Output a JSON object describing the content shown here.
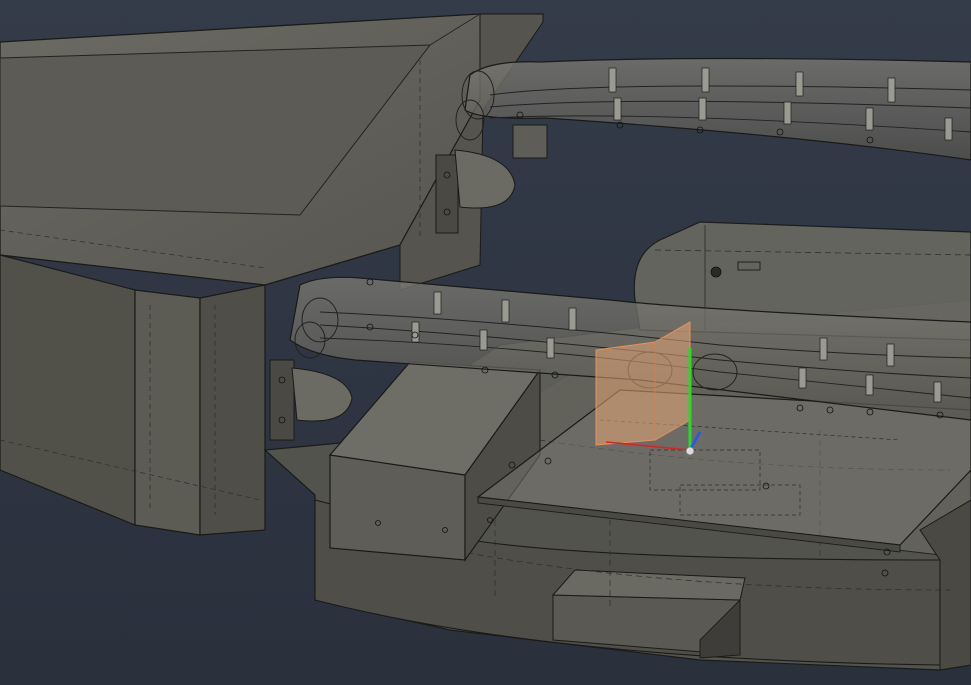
{
  "scene": {
    "kind": "cad-3d-viewport",
    "render_style": "translucent shaded with visible hidden edges",
    "colors": {
      "background_top": "#333a48",
      "background_bottom": "#2a303c",
      "body": "#5f5e58",
      "body_dark": "#4b4a45",
      "body_light": "#7a7971",
      "edge": "#1a1a18",
      "hidden_edge": "#2e2e2b",
      "plane": "#e8a878",
      "axis_y": "#22dd22",
      "axis_z": "#2255ff",
      "axis_x": "#dd2222"
    },
    "selected_feature": "sketch-plane",
    "triad": [
      "x-axis",
      "y-axis",
      "z-axis"
    ]
  }
}
